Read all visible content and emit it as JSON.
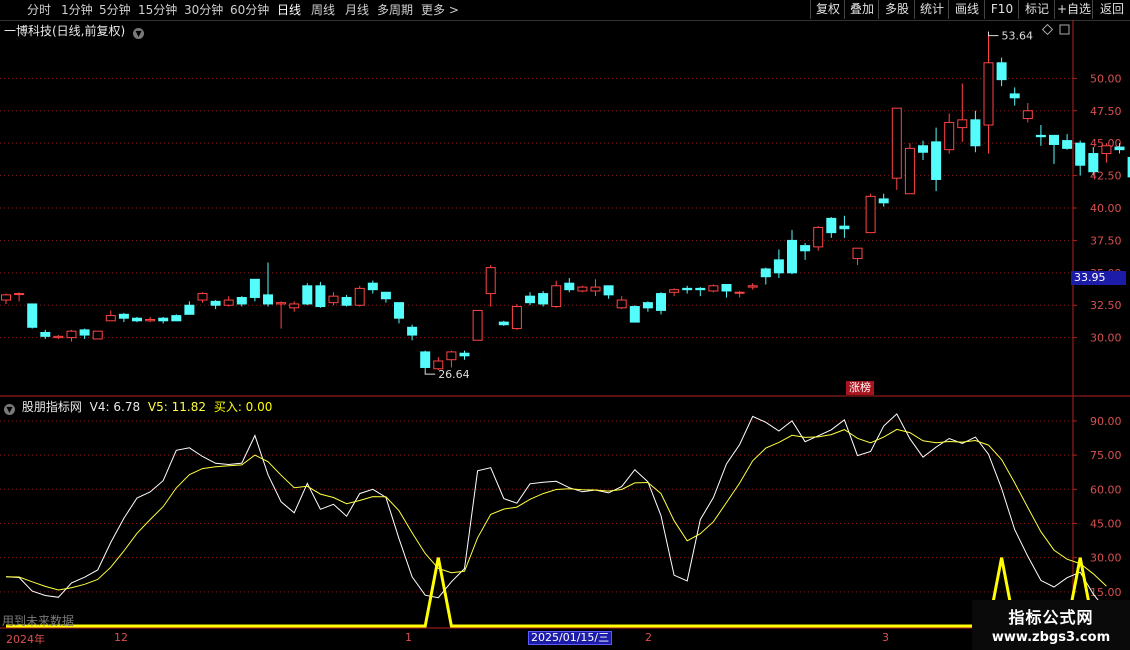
{
  "toolbar": {
    "periods": [
      "分时",
      "1分钟",
      "5分钟",
      "15分钟",
      "30分钟",
      "60分钟",
      "日线",
      "周线",
      "月线",
      "多周期",
      "更多 >"
    ],
    "active_period": "日线",
    "right_buttons": [
      "复权",
      "叠加",
      "多股",
      "统计",
      "画线",
      "F10",
      "标记",
      "+自选",
      "返回"
    ]
  },
  "stock": {
    "title": "一博科技(日线,前复权)"
  },
  "indicator": {
    "name": "股朋指标网",
    "v4": "V4: 6.78",
    "v5": "V5: 11.82",
    "buy": "买入: 0.00"
  },
  "annotations": {
    "high": "53.64",
    "low": "26.64",
    "current_price": "33.95",
    "zhangbang": "涨榜"
  },
  "x_axis": {
    "labels": [
      "2024年",
      "12",
      "1",
      "2",
      "3"
    ],
    "cursor_date": "2025/01/15/三"
  },
  "footer": {
    "future_data": "用到未来数据"
  },
  "watermark": {
    "line1": "指标公式网",
    "line2": "www.zbgs3.com"
  },
  "colors": {
    "up": "#ff4444",
    "down": "#54fcfc",
    "grid": "#8b1a1a",
    "v4": "#ffffff",
    "v5": "#ffff40",
    "buy": "#ffff00"
  },
  "chart_data": [
    {
      "type": "candlestick",
      "title": "一博科技(日线,前复权)",
      "y_ticks": [
        30.0,
        32.5,
        35.0,
        37.5,
        40.0,
        42.5,
        45.0,
        47.5,
        50.0
      ],
      "ylim": [
        25.5,
        54.5
      ],
      "candles": [
        [
          32.9,
          33.3,
          32.6,
          33.4
        ],
        [
          33.4,
          33.4,
          32.8,
          33.5
        ],
        [
          32.6,
          30.8,
          30.7,
          32.6
        ],
        [
          30.4,
          30.1,
          29.9,
          30.6
        ],
        [
          30.0,
          30.1,
          29.9,
          30.2
        ],
        [
          30.0,
          30.5,
          29.7,
          30.6
        ],
        [
          30.6,
          30.2,
          29.9,
          30.7
        ],
        [
          29.9,
          30.5,
          29.9,
          30.5
        ],
        [
          31.3,
          31.7,
          31.3,
          32.1
        ],
        [
          31.8,
          31.5,
          31.2,
          31.9
        ],
        [
          31.5,
          31.3,
          31.2,
          31.6
        ],
        [
          31.3,
          31.4,
          31.2,
          31.6
        ],
        [
          31.5,
          31.3,
          31.1,
          31.6
        ],
        [
          31.7,
          31.3,
          31.3,
          31.8
        ],
        [
          32.5,
          31.8,
          31.8,
          32.8
        ],
        [
          32.9,
          33.4,
          32.7,
          33.5
        ],
        [
          32.8,
          32.5,
          32.2,
          32.9
        ],
        [
          32.5,
          32.9,
          32.4,
          33.2
        ],
        [
          33.1,
          32.6,
          32.4,
          33.2
        ],
        [
          34.5,
          33.1,
          32.8,
          34.5
        ],
        [
          33.3,
          32.6,
          32.4,
          35.8
        ],
        [
          32.6,
          32.7,
          30.7,
          32.8
        ],
        [
          32.3,
          32.6,
          32.0,
          32.8
        ],
        [
          34.0,
          32.6,
          32.5,
          34.2
        ],
        [
          34.0,
          32.4,
          32.3,
          34.3
        ],
        [
          32.7,
          33.2,
          32.5,
          33.5
        ],
        [
          33.1,
          32.5,
          32.4,
          33.3
        ],
        [
          32.5,
          33.8,
          32.4,
          34.0
        ],
        [
          34.2,
          33.7,
          33.4,
          34.4
        ],
        [
          33.5,
          33.0,
          32.7,
          33.5
        ],
        [
          32.7,
          31.5,
          31.1,
          32.7
        ],
        [
          30.8,
          30.2,
          29.8,
          31.0
        ],
        [
          28.9,
          27.7,
          27.5,
          29.0
        ],
        [
          27.6,
          28.2,
          27.5,
          28.5
        ],
        [
          28.3,
          28.9,
          27.7,
          29.0
        ],
        [
          28.8,
          28.6,
          28.3,
          29.0
        ],
        [
          29.8,
          32.1,
          29.8,
          32.1
        ],
        [
          33.4,
          35.4,
          32.4,
          35.6
        ],
        [
          31.2,
          31.0,
          30.9,
          31.3
        ],
        [
          30.7,
          32.4,
          30.6,
          32.6
        ],
        [
          33.2,
          32.7,
          32.5,
          33.5
        ],
        [
          33.4,
          32.6,
          32.4,
          33.6
        ],
        [
          32.4,
          34.0,
          32.3,
          34.4
        ],
        [
          34.2,
          33.7,
          33.5,
          34.6
        ],
        [
          33.6,
          33.9,
          33.5,
          34.0
        ],
        [
          33.6,
          33.9,
          33.2,
          34.5
        ],
        [
          34.0,
          33.3,
          33.0,
          34.0
        ],
        [
          32.3,
          32.9,
          32.2,
          33.2
        ],
        [
          32.4,
          31.2,
          31.2,
          32.5
        ],
        [
          32.7,
          32.3,
          32.0,
          32.8
        ],
        [
          33.4,
          32.1,
          31.8,
          33.5
        ],
        [
          33.5,
          33.7,
          33.2,
          33.8
        ],
        [
          33.8,
          33.7,
          33.4,
          34.0
        ],
        [
          33.8,
          33.7,
          33.2,
          33.9
        ],
        [
          33.6,
          34.0,
          33.5,
          34.1
        ],
        [
          34.1,
          33.6,
          33.1,
          34.1
        ],
        [
          33.5,
          33.5,
          33.1,
          33.6
        ],
        [
          33.9,
          34.0,
          33.7,
          34.2
        ],
        [
          35.3,
          34.7,
          34.1,
          35.4
        ],
        [
          36.0,
          35.0,
          34.6,
          36.8
        ],
        [
          37.5,
          35.0,
          34.9,
          38.3
        ],
        [
          37.1,
          36.7,
          36.0,
          37.3
        ],
        [
          37.0,
          38.5,
          36.7,
          38.6
        ],
        [
          39.2,
          38.1,
          37.7,
          39.3
        ],
        [
          38.6,
          38.4,
          37.7,
          39.4
        ],
        [
          36.1,
          36.9,
          35.6,
          36.9
        ],
        [
          38.1,
          40.9,
          38.1,
          41.1
        ],
        [
          40.7,
          40.4,
          40.1,
          41.1
        ],
        [
          42.3,
          47.7,
          41.4,
          47.7
        ],
        [
          41.1,
          44.6,
          41.1,
          45.0
        ],
        [
          44.8,
          44.3,
          43.7,
          45.2
        ],
        [
          45.1,
          42.2,
          41.3,
          46.2
        ],
        [
          44.5,
          46.6,
          44.2,
          47.3
        ],
        [
          46.2,
          46.8,
          45.1,
          49.6
        ],
        [
          46.8,
          44.8,
          44.3,
          47.5
        ],
        [
          46.4,
          51.2,
          44.2,
          53.6
        ],
        [
          51.2,
          49.9,
          49.4,
          51.6
        ],
        [
          48.8,
          48.5,
          47.9,
          49.3
        ],
        [
          46.9,
          47.5,
          46.6,
          48.1
        ],
        [
          45.6,
          45.5,
          44.8,
          46.4
        ],
        [
          45.6,
          44.9,
          43.4,
          45.6
        ],
        [
          45.2,
          44.6,
          44.5,
          45.7
        ],
        [
          45.0,
          43.3,
          42.5,
          45.2
        ],
        [
          44.2,
          42.8,
          42.5,
          44.7
        ],
        [
          44.2,
          44.8,
          43.5,
          45.0
        ],
        [
          44.7,
          44.5,
          44.2,
          45.0
        ],
        [
          43.9,
          42.4,
          42.4,
          44.0
        ],
        [
          42.6,
          42.8,
          42.5,
          42.9
        ],
        [
          41.9,
          41.0,
          40.7,
          42.3
        ]
      ]
    },
    {
      "type": "line",
      "title": "股朋指标网",
      "y_ticks": [
        15.0,
        30.0,
        45.0,
        60.0,
        75.0,
        90.0
      ],
      "ylim": [
        0,
        97
      ],
      "series": [
        {
          "name": "V4",
          "values": [
            21.6,
            21.3,
            15.3,
            13.4,
            12.6,
            18.9,
            21.4,
            24.6,
            36.7,
            47.3,
            56.2,
            58.8,
            63.8,
            77.1,
            78.2,
            74.4,
            71.4,
            70.9,
            71.5,
            83.6,
            66.4,
            54.5,
            49.7,
            62.6,
            51.2,
            53.4,
            48.2,
            58.1,
            60.0,
            56.5,
            38.3,
            21.6,
            13.5,
            12.4,
            19.4,
            25.2,
            68.1,
            69.5,
            55.9,
            53.9,
            62.4,
            63.1,
            63.5,
            60.7,
            58.9,
            59.7,
            58.4,
            61.2,
            68.6,
            63.3,
            48.4,
            22.3,
            19.8,
            46.7,
            56.4,
            71.2,
            79.6,
            92.0,
            89.4,
            85.6,
            90.0,
            80.9,
            83.5,
            86.1,
            90.5,
            74.8,
            76.6,
            87.8,
            93.1,
            82.2,
            74.1,
            78.5,
            82.3,
            80.1,
            82.9,
            75.4,
            60.4,
            42.3,
            30.6,
            20.0,
            17.1,
            21.2,
            23.6,
            14.0,
            6.8
          ]
        },
        {
          "name": "V5",
          "values": [
            21.6,
            21.5,
            19.4,
            17.4,
            15.8,
            16.8,
            18.3,
            20.4,
            25.8,
            32.9,
            40.7,
            46.7,
            52.4,
            60.6,
            66.4,
            69.1,
            69.9,
            70.3,
            70.7,
            75.0,
            72.1,
            66.2,
            60.7,
            61.3,
            57.9,
            56.4,
            53.7,
            55.1,
            56.8,
            56.7,
            50.6,
            40.9,
            31.8,
            25.3,
            23.4,
            24.0,
            38.7,
            49.0,
            51.3,
            52.2,
            55.6,
            58.1,
            59.9,
            60.2,
            59.8,
            59.7,
            59.2,
            59.9,
            62.8,
            63.0,
            58.1,
            46.2,
            37.4,
            40.5,
            45.8,
            54.2,
            62.7,
            72.5,
            78.1,
            80.6,
            83.7,
            82.8,
            83.0,
            84.0,
            86.2,
            82.4,
            80.4,
            82.9,
            86.3,
            84.9,
            81.3,
            80.4,
            81.0,
            80.7,
            81.4,
            79.4,
            73.1,
            62.8,
            52.0,
            41.4,
            33.3,
            29.3,
            27.4,
            22.9,
            17.5
          ]
        },
        {
          "name": "买入",
          "values": [
            0,
            0,
            0,
            0,
            0,
            0,
            0,
            0,
            0,
            0,
            0,
            0,
            0,
            0,
            0,
            0,
            0,
            0,
            0,
            0,
            0,
            0,
            0,
            0,
            0,
            0,
            0,
            0,
            0,
            0,
            0,
            0,
            0,
            30,
            0,
            0,
            0,
            0,
            0,
            0,
            0,
            0,
            0,
            0,
            0,
            0,
            0,
            0,
            0,
            0,
            0,
            0,
            0,
            0,
            0,
            0,
            0,
            0,
            0,
            0,
            0,
            0,
            0,
            0,
            0,
            0,
            0,
            0,
            0,
            0,
            0,
            0,
            0,
            0,
            0,
            0,
            30,
            0,
            0,
            0,
            0,
            0,
            30,
            0,
            0,
            0,
            0,
            0,
            0,
            0,
            0,
            0,
            0,
            0,
            0
          ]
        }
      ]
    }
  ]
}
